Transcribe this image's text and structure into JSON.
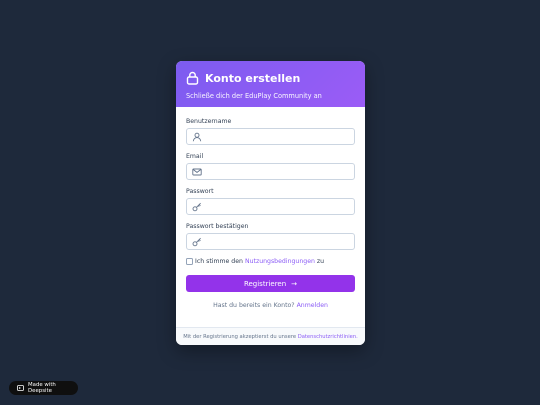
{
  "header": {
    "title": "Konto erstellen",
    "subtitle": "Schließe dich der EduPlay Community an",
    "icon": "lock-icon"
  },
  "form": {
    "username": {
      "label": "Benutzername",
      "value": "",
      "icon": "user-icon"
    },
    "email": {
      "label": "Email",
      "value": "",
      "icon": "mail-icon"
    },
    "password": {
      "label": "Passwort",
      "value": "",
      "icon": "key-icon"
    },
    "password_confirm": {
      "label": "Passwort bestätigen",
      "value": "",
      "icon": "key-icon"
    },
    "terms": {
      "prefix": "Ich stimme den",
      "link": "Nutzungsbedingungen",
      "suffix": "zu",
      "checked": false
    },
    "submit_label": "Registrieren",
    "submit_arrow": "→",
    "login_prompt": "Hast du bereits ein Konto?",
    "login_link": "Anmelden"
  },
  "footer": {
    "prefix": "Mit der Registrierung akzeptierst du unsere",
    "link": "Datenschutzrichtlinien."
  },
  "badge": {
    "label": "Made with Deepsite"
  },
  "colors": {
    "accent": "#8b5cf6",
    "button": "#9333ea",
    "background": "#1e293b"
  }
}
